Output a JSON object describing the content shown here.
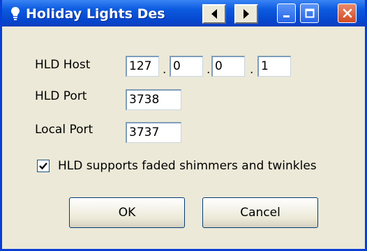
{
  "window": {
    "title": "Holiday Lights Des",
    "icons": {
      "app": "lightbulb-icon",
      "scroll_left": "arrow-left-icon",
      "scroll_right": "arrow-right-icon",
      "minimize": "minimize-icon",
      "maximize": "maximize-icon",
      "close": "close-icon"
    }
  },
  "form": {
    "host_label": "HLD Host",
    "host_octets": [
      "127",
      "0",
      "0",
      "1"
    ],
    "ip_separator": ".",
    "port_label": "HLD Port",
    "port_value": "3738",
    "local_port_label": "Local Port",
    "local_port_value": "3737",
    "checkbox_label": "HLD supports faded shimmers and twinkles",
    "checkbox_checked": true
  },
  "buttons": {
    "ok": "OK",
    "cancel": "Cancel"
  }
}
